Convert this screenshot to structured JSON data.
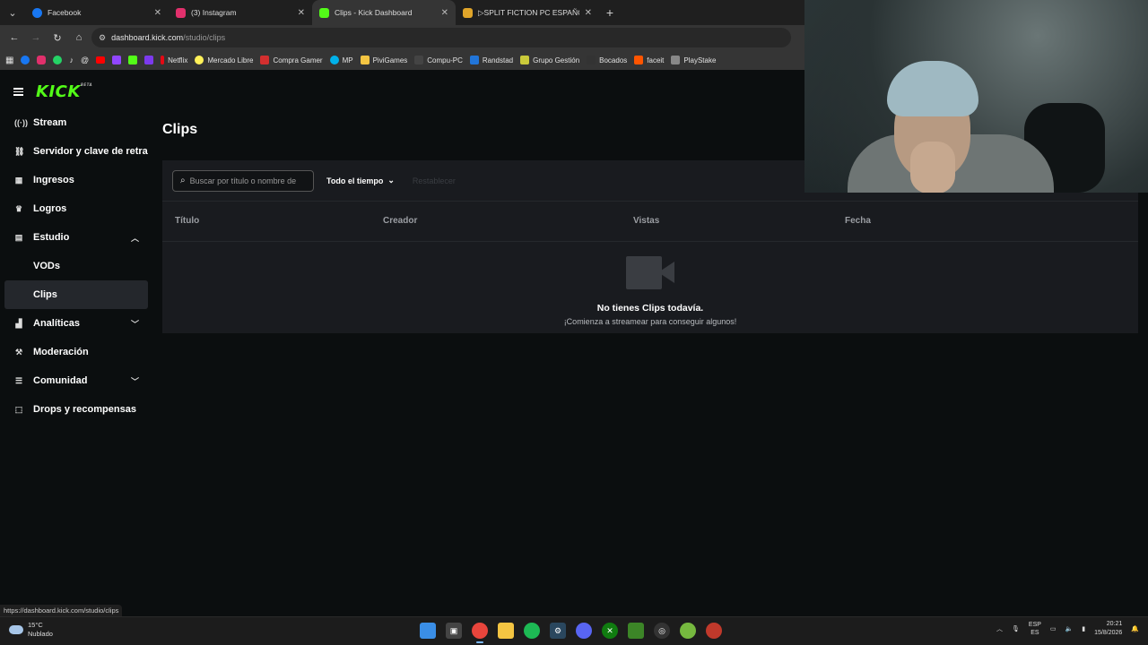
{
  "browser": {
    "tabs": [
      {
        "title": "Facebook",
        "color": "#1877f2"
      },
      {
        "title": "(3) Instagram",
        "color": "#e1306c"
      },
      {
        "title": "Clips - Kick Dashboard",
        "color": "#53fc18"
      },
      {
        "title": "▷SPLIT FICTION PC ESPAÑOL -",
        "color": "#e0a52a"
      }
    ],
    "url_host": "dashboard.kick.com",
    "url_path": "/studio/clips",
    "bookmarks": [
      {
        "label": "Netflix",
        "color": "#e50914"
      },
      {
        "label": "Mercado Libre",
        "color": "#fff159"
      },
      {
        "label": "Compra Gamer",
        "color": "#d32f2f"
      },
      {
        "label": "MP",
        "color": "#00b1ea"
      },
      {
        "label": "PiviGames",
        "color": "#f4c542"
      },
      {
        "label": "Compu-PC",
        "color": "#444"
      },
      {
        "label": "Randstad",
        "color": "#2175d9"
      },
      {
        "label": "Grupo Gestión",
        "color": "#c9c93a"
      },
      {
        "label": "Bocados",
        "color": "#333"
      },
      {
        "label": "faceit",
        "color": "#ff5500"
      },
      {
        "label": "PlayStake",
        "color": "#888"
      }
    ],
    "status_url": "https://dashboard.kick.com/studio/clips"
  },
  "sidebar": {
    "logo": "KICK",
    "logo_badge": "BETA",
    "items": [
      {
        "label": "Stream",
        "icon": "⟨·⟩"
      },
      {
        "label": "Servidor y clave de retransmisión",
        "icon": "⛓"
      },
      {
        "label": "Ingresos",
        "icon": "▦"
      },
      {
        "label": "Logros",
        "icon": "🏆"
      },
      {
        "label": "Estudio",
        "icon": "▤"
      },
      {
        "label": "VODs",
        "icon": ""
      },
      {
        "label": "Clips",
        "icon": ""
      },
      {
        "label": "Analíticas",
        "icon": "▟"
      },
      {
        "label": "Moderación",
        "icon": "⚒"
      },
      {
        "label": "Comunidad",
        "icon": "☰"
      },
      {
        "label": "Drops y recompensas",
        "icon": "⬚"
      }
    ]
  },
  "main": {
    "title": "Clips",
    "search_placeholder": "Buscar por título o nombre de",
    "time_filter": "Todo el tiempo",
    "disabled_action": "Restablecer",
    "columns": [
      "Título",
      "Creador",
      "Vistas",
      "Fecha"
    ],
    "empty_title": "No tienes Clips todavía.",
    "empty_sub": "¡Comienza a streamear para conseguir algunos!"
  },
  "taskbar": {
    "temperature": "15°C",
    "weather": "Nublado",
    "lang_top": "ESP",
    "lang_bottom": "ES",
    "time": "20:21",
    "date": "15/8/2026"
  }
}
